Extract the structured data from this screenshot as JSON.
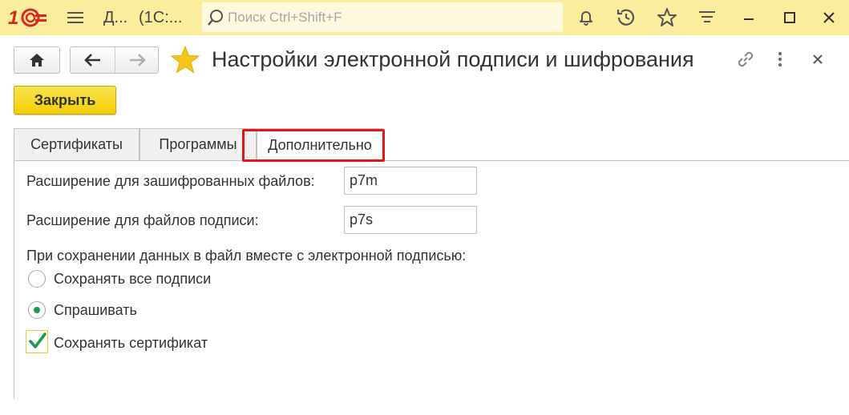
{
  "topbar": {
    "title_short": "Д...",
    "title_app": "(1С:...",
    "search_placeholder": "Поиск Ctrl+Shift+F",
    "icons": [
      "logo-1c-icon",
      "menu-icon",
      "search-icon",
      "bell-icon",
      "history-icon",
      "star-icon",
      "panel-menu-icon",
      "minimize-icon",
      "maximize-icon",
      "close-icon"
    ]
  },
  "form": {
    "title": "Настройки электронной подписи и шифрования",
    "close_button": "Закрыть",
    "header_icons": [
      "home-icon",
      "back-arrow-icon",
      "forward-arrow-icon",
      "favorite-star-icon",
      "link-icon",
      "more-vertical-icon",
      "close-form-icon"
    ]
  },
  "tabs": [
    {
      "label": "Сертификаты",
      "active": false
    },
    {
      "label": "Программы",
      "active": false
    },
    {
      "label": "Дополнительно",
      "active": true
    }
  ],
  "settings": {
    "encrypted_ext_label": "Расширение для зашифрованных файлов:",
    "encrypted_ext_value": "p7m",
    "signature_ext_label": "Расширение для файлов подписи:",
    "signature_ext_value": "p7s",
    "save_group_label": "При сохранении данных в файл вместе с электронной подписью:",
    "options": [
      {
        "label": "Сохранять все подписи",
        "selected": false
      },
      {
        "label": "Спрашивать",
        "selected": true
      }
    ],
    "save_certificate_label": "Сохранять сертификат",
    "save_certificate_checked": true
  },
  "colors": {
    "topbar_bg": "#fbed9e",
    "close_button_bg": "#f5d313",
    "highlight_frame": "#e3161a",
    "check_green": "#1f9b4d",
    "logo_red": "#d92a1f"
  }
}
